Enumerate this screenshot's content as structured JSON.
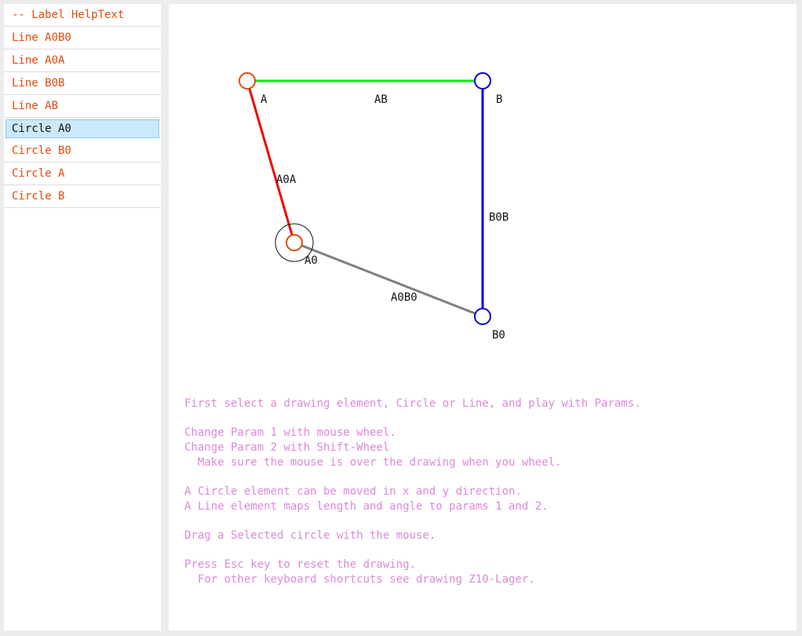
{
  "sidebar": {
    "items": [
      {
        "label": "-- Label HelpText",
        "selected": false
      },
      {
        "label": "Line A0B0",
        "selected": false
      },
      {
        "label": "Line A0A",
        "selected": false
      },
      {
        "label": "Line B0B",
        "selected": false
      },
      {
        "label": "Line AB",
        "selected": false
      },
      {
        "label": "Circle A0",
        "selected": true
      },
      {
        "label": "Circle B0",
        "selected": false
      },
      {
        "label": "Circle A",
        "selected": false
      },
      {
        "label": "Circle B",
        "selected": false
      }
    ]
  },
  "drawing": {
    "points": {
      "A": {
        "label": "A",
        "color": "#e04b0d"
      },
      "B": {
        "label": "B",
        "color": "#0000cc"
      },
      "A0": {
        "label": "A0",
        "color": "#e04b0d"
      },
      "B0": {
        "label": "B0",
        "color": "#0000cc"
      }
    },
    "lines": {
      "AB": {
        "label": "AB",
        "color": "#00ee00"
      },
      "A0A": {
        "label": "A0A",
        "color": "#ee0000"
      },
      "B0B": {
        "label": "B0B",
        "color": "#0000dd"
      },
      "A0B0": {
        "label": "A0B0",
        "color": "#808080"
      }
    }
  },
  "help": {
    "lines": [
      "First select a drawing element, Circle or Line, and play with Params.",
      "",
      "Change Param 1 with mouse wheel.",
      "Change Param 2 with Shift-Wheel",
      "  Make sure the mouse is over the drawing when you wheel.",
      "",
      "A Circle element can be moved in x and y direction.",
      "A Line element maps length and angle to params 1 and 2.",
      "",
      "Drag a Selected circle with the mouse.",
      "",
      "Press Esc key to reset the drawing.",
      "  For other keyboard shortcuts see drawing Z10-Lager."
    ],
    "color": "#da8ad8"
  }
}
